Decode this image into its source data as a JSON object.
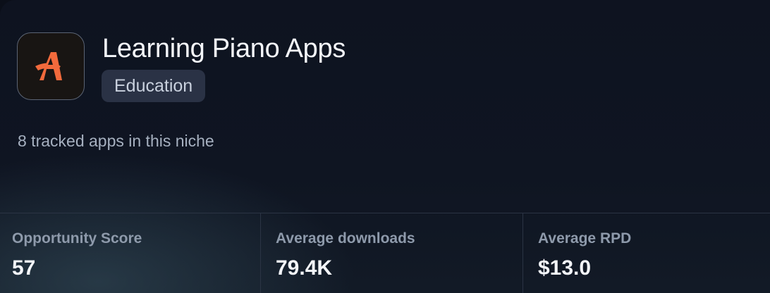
{
  "app": {
    "icon": "stylized-a-logo-icon",
    "title": "Learning Piano Apps",
    "category": "Education",
    "tracked_text": "8 tracked apps in this niche"
  },
  "stats": [
    {
      "label": "Opportunity Score",
      "value": "57"
    },
    {
      "label": "Average downloads",
      "value": "79.4K"
    },
    {
      "label": "Average RPD",
      "value": "$13.0"
    }
  ],
  "colors": {
    "background": "#0e1320",
    "logo_accent": "#f26a3c",
    "badge_bg": "#2a3245"
  }
}
